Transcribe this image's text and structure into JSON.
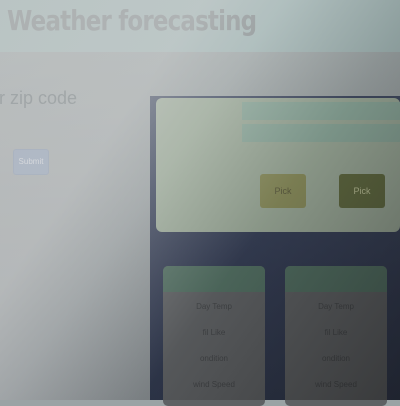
{
  "header": {
    "title": "Weather forecasting"
  },
  "form": {
    "zip_label": "ur zip code",
    "submit_label": "Submit"
  },
  "panel": {
    "button_1": "Pick",
    "button_2": "Pick"
  },
  "cards": [
    {
      "day_temp": "Day Temp",
      "feels_like": "fil Like",
      "condition": "ondition",
      "wind_speed": "wind Speed"
    },
    {
      "day_temp": "Day Temp",
      "feels_like": "fil Like",
      "condition": "ondition",
      "wind_speed": "wind Speed"
    }
  ],
  "colors": {
    "header_bg": "#a9c0bf",
    "panel_bg": "#a2b39f",
    "button_1": "#8e9259",
    "button_2": "#5f6a3a",
    "backdrop": "#2b3550",
    "submit": "#8fa2bd"
  }
}
